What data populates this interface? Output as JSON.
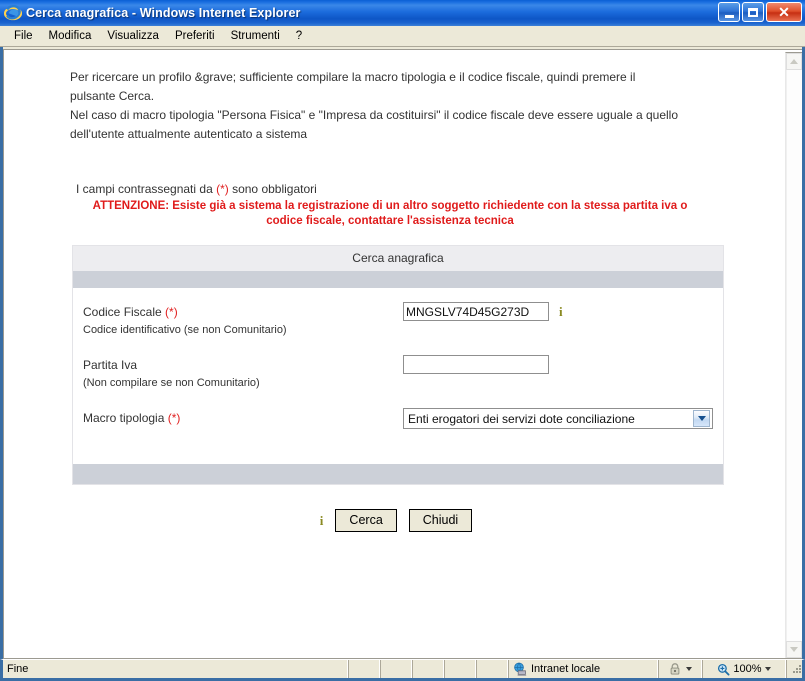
{
  "window": {
    "title": "Cerca anagrafica - Windows Internet Explorer",
    "app_icon": "internet-explorer-icon",
    "controls": {
      "minimize": "minimize-button",
      "maximize": "maximize-button",
      "close_glyph": "✕"
    }
  },
  "menubar": {
    "items": [
      {
        "label": "File"
      },
      {
        "label": "Modifica"
      },
      {
        "label": "Visualizza"
      },
      {
        "label": "Preferiti"
      },
      {
        "label": "Strumenti"
      },
      {
        "label": "?"
      }
    ]
  },
  "content": {
    "intro_line1": "Per ricercare un profilo &grave; sufficiente compilare la macro tipologia e il codice fiscale, quindi premere il",
    "intro_line2": "pulsante Cerca.",
    "intro_line3": "Nel caso di macro tipologia \"Persona Fisica\" e \"Impresa da costituirsi\" il codice fiscale deve essere uguale a quello",
    "intro_line4": "dell'utente attualmente autenticato a sistema",
    "required_note_before": "I campi contrassegnati da ",
    "required_note_marker": "(*)",
    "required_note_after": " sono obbligatori",
    "warning_line1": "ATTENZIONE: Esiste già a sistema la registrazione di un altro soggetto richiedente con la stessa partita iva o",
    "warning_line2": "codice fiscale, contattare l'assistenza tecnica",
    "warning_color": "#e01b1b"
  },
  "form": {
    "header": "Cerca anagrafica",
    "fields": {
      "codice_fiscale": {
        "label": "Codice Fiscale",
        "required_marker": "(*)",
        "sublabel": "Codice identificativo (se non Comunitario)",
        "value": "MNGSLV74D45G273D",
        "placeholder": "",
        "info_icon": "info-icon"
      },
      "partita_iva": {
        "label": "Partita Iva",
        "sublabel": "(Non compilare se non Comunitario)",
        "value": "",
        "placeholder": ""
      },
      "macro_tipologia": {
        "label": "Macro tipologia",
        "required_marker": "(*)",
        "selected": "Enti erogatori dei servizi dote conciliazione"
      }
    }
  },
  "actions": {
    "info_icon": "info-icon",
    "search_label": "Cerca",
    "close_label": "Chiudi"
  },
  "statusbar": {
    "status_text": "Fine",
    "zone_label": "Intranet locale",
    "zone_icon": "intranet-zone-icon",
    "security_icon": "security-lock-icon",
    "zoom_icon": "zoom-magnifier-icon",
    "zoom_level": "100%"
  }
}
